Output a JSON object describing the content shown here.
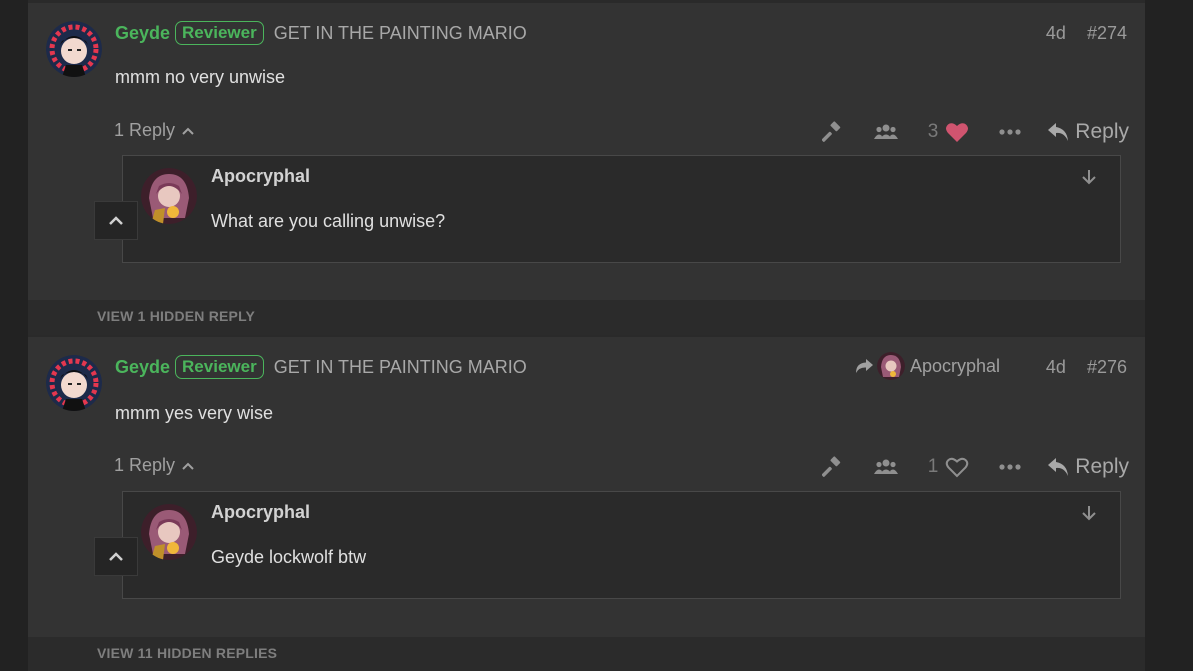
{
  "posts": [
    {
      "author": "Geyde",
      "badge": "Reviewer",
      "user_title": "GET IN THE PAINTING MARIO",
      "date": "4d",
      "post_number": "#274",
      "content": "mmm no very unwise",
      "replies_label": "1 Reply",
      "like_count": "3",
      "liked": true,
      "reply_label": "Reply",
      "embedded_reply": {
        "author": "Apocryphal",
        "content": "What are you calling unwise?"
      }
    },
    {
      "author": "Geyde",
      "badge": "Reviewer",
      "user_title": "GET IN THE PAINTING MARIO",
      "reply_to_user": "Apocryphal",
      "date": "4d",
      "post_number": "#276",
      "content": "mmm yes very wise",
      "replies_label": "1 Reply",
      "like_count": "1",
      "liked": false,
      "reply_label": "Reply",
      "embedded_reply": {
        "author": "Apocryphal",
        "content": "Geyde lockwolf btw"
      }
    }
  ],
  "hidden_replies": [
    "VIEW 1 HIDDEN REPLY",
    "VIEW 11 HIDDEN REPLIES"
  ],
  "colors": {
    "username": "#4bb55c",
    "like_heart": "#d0546f",
    "background": "#333333"
  },
  "icons": [
    "gavel-icon",
    "users-icon",
    "heart-icon",
    "ellipsis-icon",
    "reply-icon",
    "chevron-up-icon",
    "arrow-down-icon",
    "share-icon"
  ]
}
